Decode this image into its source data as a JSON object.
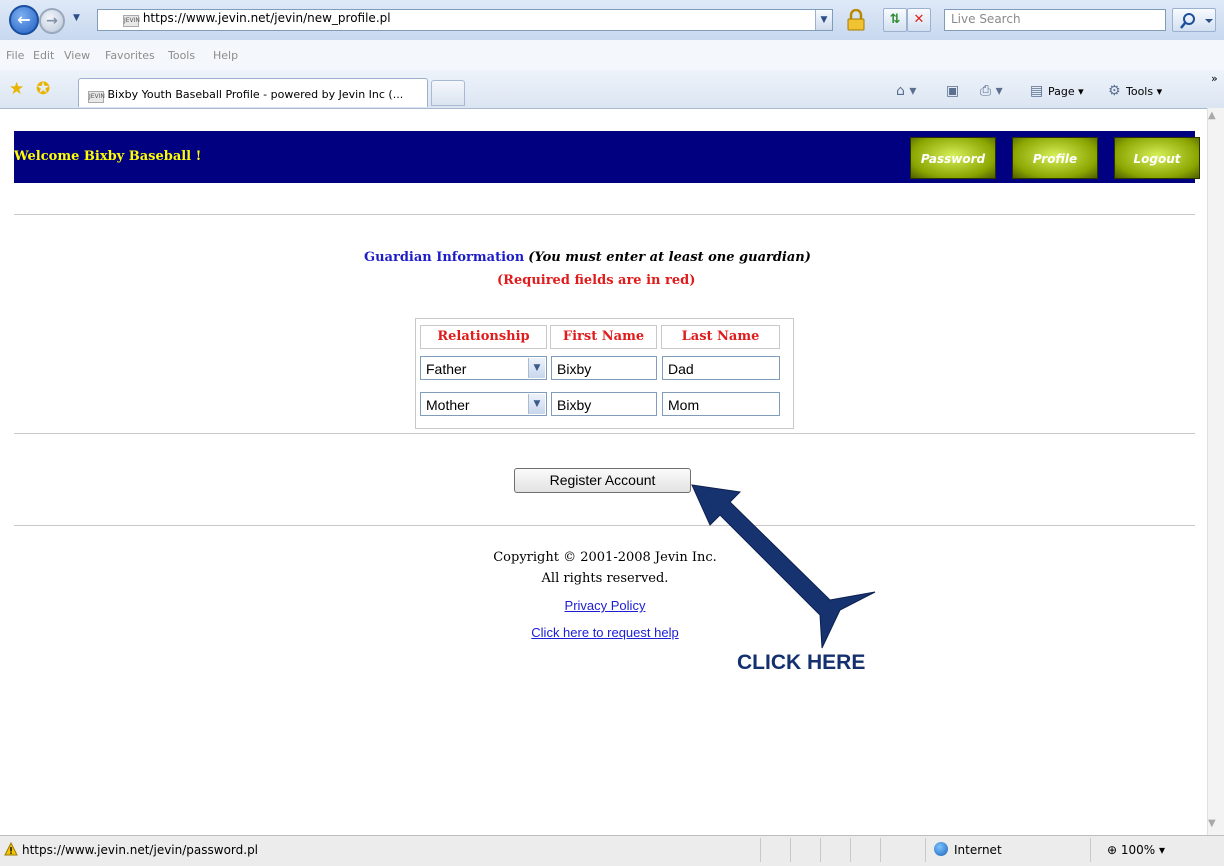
{
  "browser": {
    "url": "https://www.jevin.net/jevin/new_profile.pl",
    "favicon_text": "JEVIN",
    "search_placeholder": "Live Search",
    "menu": [
      "File",
      "Edit",
      "View",
      "Favorites",
      "Tools",
      "Help"
    ],
    "tab_title": "Bixby Youth Baseball Profile - powered by Jevin Inc (...",
    "commands": {
      "page": "Page",
      "tools": "Tools"
    },
    "status_url": "https://www.jevin.net/jevin/password.pl",
    "zone": "Internet",
    "zoom": "100%"
  },
  "header": {
    "welcome": "Welcome Bixby Baseball !",
    "nav": {
      "password": "Password",
      "profile": "Profile",
      "logout": "Logout"
    },
    "banner_color": "#000080",
    "welcome_color": "#ffff00"
  },
  "guardian": {
    "title": "Guardian Information",
    "note": "(You must enter at least one guardian)",
    "required_note": "(Required fields are in red)",
    "columns": [
      "Relationship",
      "First Name",
      "Last Name"
    ],
    "rows": [
      {
        "relationship": "Father",
        "first_name": "Bixby",
        "last_name": "Dad"
      },
      {
        "relationship": "Mother",
        "first_name": "Bixby",
        "last_name": "Mom"
      }
    ]
  },
  "actions": {
    "register": "Register Account"
  },
  "footer": {
    "copyright": "Copyright © 2001-2008 Jevin Inc.",
    "rights": "All rights reserved.",
    "privacy": "Privacy Policy",
    "help": "Click here to request help"
  },
  "annotation": {
    "label": "CLICK HERE",
    "color": "#14306e"
  }
}
